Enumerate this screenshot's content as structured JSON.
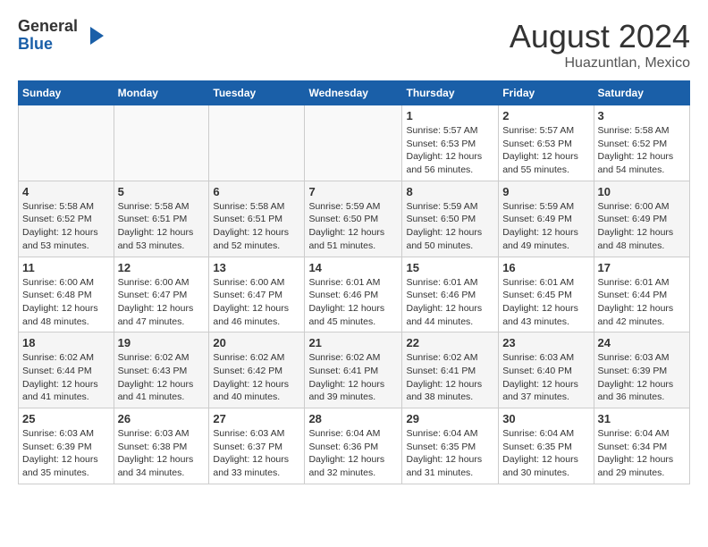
{
  "logo": {
    "general": "General",
    "blue": "Blue"
  },
  "title": {
    "month_year": "August 2024",
    "location": "Huazuntlan, Mexico"
  },
  "days_of_week": [
    "Sunday",
    "Monday",
    "Tuesday",
    "Wednesday",
    "Thursday",
    "Friday",
    "Saturday"
  ],
  "weeks": [
    [
      {
        "day": "",
        "info": ""
      },
      {
        "day": "",
        "info": ""
      },
      {
        "day": "",
        "info": ""
      },
      {
        "day": "",
        "info": ""
      },
      {
        "day": "1",
        "info": "Sunrise: 5:57 AM\nSunset: 6:53 PM\nDaylight: 12 hours\nand 56 minutes."
      },
      {
        "day": "2",
        "info": "Sunrise: 5:57 AM\nSunset: 6:53 PM\nDaylight: 12 hours\nand 55 minutes."
      },
      {
        "day": "3",
        "info": "Sunrise: 5:58 AM\nSunset: 6:52 PM\nDaylight: 12 hours\nand 54 minutes."
      }
    ],
    [
      {
        "day": "4",
        "info": "Sunrise: 5:58 AM\nSunset: 6:52 PM\nDaylight: 12 hours\nand 53 minutes."
      },
      {
        "day": "5",
        "info": "Sunrise: 5:58 AM\nSunset: 6:51 PM\nDaylight: 12 hours\nand 53 minutes."
      },
      {
        "day": "6",
        "info": "Sunrise: 5:58 AM\nSunset: 6:51 PM\nDaylight: 12 hours\nand 52 minutes."
      },
      {
        "day": "7",
        "info": "Sunrise: 5:59 AM\nSunset: 6:50 PM\nDaylight: 12 hours\nand 51 minutes."
      },
      {
        "day": "8",
        "info": "Sunrise: 5:59 AM\nSunset: 6:50 PM\nDaylight: 12 hours\nand 50 minutes."
      },
      {
        "day": "9",
        "info": "Sunrise: 5:59 AM\nSunset: 6:49 PM\nDaylight: 12 hours\nand 49 minutes."
      },
      {
        "day": "10",
        "info": "Sunrise: 6:00 AM\nSunset: 6:49 PM\nDaylight: 12 hours\nand 48 minutes."
      }
    ],
    [
      {
        "day": "11",
        "info": "Sunrise: 6:00 AM\nSunset: 6:48 PM\nDaylight: 12 hours\nand 48 minutes."
      },
      {
        "day": "12",
        "info": "Sunrise: 6:00 AM\nSunset: 6:47 PM\nDaylight: 12 hours\nand 47 minutes."
      },
      {
        "day": "13",
        "info": "Sunrise: 6:00 AM\nSunset: 6:47 PM\nDaylight: 12 hours\nand 46 minutes."
      },
      {
        "day": "14",
        "info": "Sunrise: 6:01 AM\nSunset: 6:46 PM\nDaylight: 12 hours\nand 45 minutes."
      },
      {
        "day": "15",
        "info": "Sunrise: 6:01 AM\nSunset: 6:46 PM\nDaylight: 12 hours\nand 44 minutes."
      },
      {
        "day": "16",
        "info": "Sunrise: 6:01 AM\nSunset: 6:45 PM\nDaylight: 12 hours\nand 43 minutes."
      },
      {
        "day": "17",
        "info": "Sunrise: 6:01 AM\nSunset: 6:44 PM\nDaylight: 12 hours\nand 42 minutes."
      }
    ],
    [
      {
        "day": "18",
        "info": "Sunrise: 6:02 AM\nSunset: 6:44 PM\nDaylight: 12 hours\nand 41 minutes."
      },
      {
        "day": "19",
        "info": "Sunrise: 6:02 AM\nSunset: 6:43 PM\nDaylight: 12 hours\nand 41 minutes."
      },
      {
        "day": "20",
        "info": "Sunrise: 6:02 AM\nSunset: 6:42 PM\nDaylight: 12 hours\nand 40 minutes."
      },
      {
        "day": "21",
        "info": "Sunrise: 6:02 AM\nSunset: 6:41 PM\nDaylight: 12 hours\nand 39 minutes."
      },
      {
        "day": "22",
        "info": "Sunrise: 6:02 AM\nSunset: 6:41 PM\nDaylight: 12 hours\nand 38 minutes."
      },
      {
        "day": "23",
        "info": "Sunrise: 6:03 AM\nSunset: 6:40 PM\nDaylight: 12 hours\nand 37 minutes."
      },
      {
        "day": "24",
        "info": "Sunrise: 6:03 AM\nSunset: 6:39 PM\nDaylight: 12 hours\nand 36 minutes."
      }
    ],
    [
      {
        "day": "25",
        "info": "Sunrise: 6:03 AM\nSunset: 6:39 PM\nDaylight: 12 hours\nand 35 minutes."
      },
      {
        "day": "26",
        "info": "Sunrise: 6:03 AM\nSunset: 6:38 PM\nDaylight: 12 hours\nand 34 minutes."
      },
      {
        "day": "27",
        "info": "Sunrise: 6:03 AM\nSunset: 6:37 PM\nDaylight: 12 hours\nand 33 minutes."
      },
      {
        "day": "28",
        "info": "Sunrise: 6:04 AM\nSunset: 6:36 PM\nDaylight: 12 hours\nand 32 minutes."
      },
      {
        "day": "29",
        "info": "Sunrise: 6:04 AM\nSunset: 6:35 PM\nDaylight: 12 hours\nand 31 minutes."
      },
      {
        "day": "30",
        "info": "Sunrise: 6:04 AM\nSunset: 6:35 PM\nDaylight: 12 hours\nand 30 minutes."
      },
      {
        "day": "31",
        "info": "Sunrise: 6:04 AM\nSunset: 6:34 PM\nDaylight: 12 hours\nand 29 minutes."
      }
    ]
  ]
}
